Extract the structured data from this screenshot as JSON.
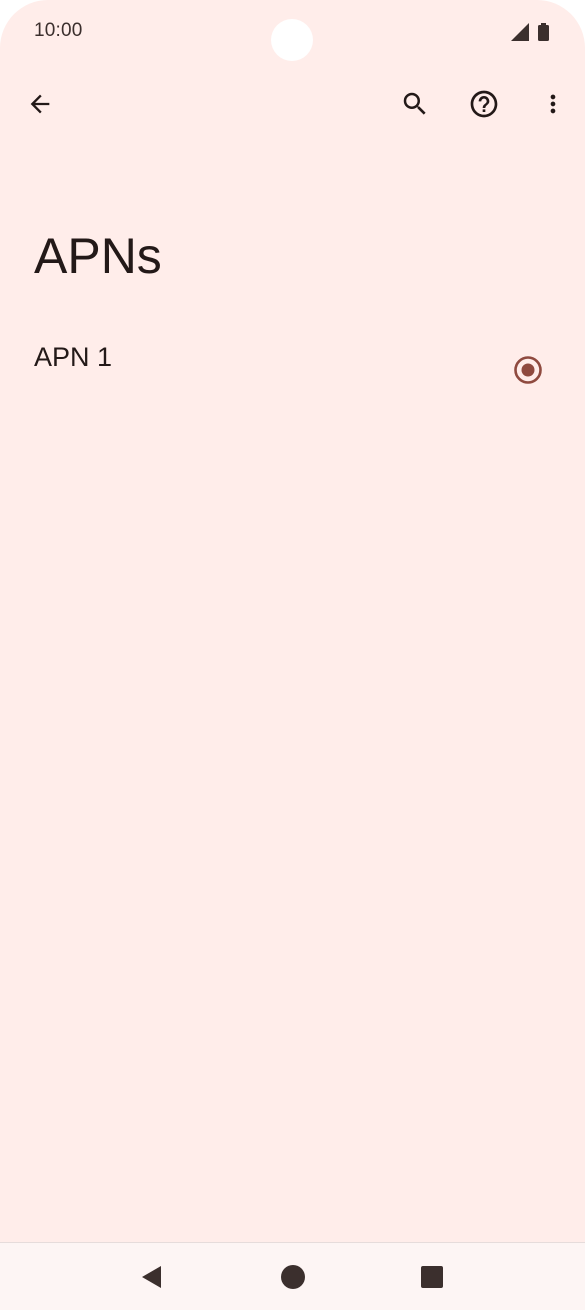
{
  "status_bar": {
    "time": "10:00",
    "icons": [
      "signal-icon",
      "battery-icon"
    ]
  },
  "toolbar": {
    "icons": [
      "back-arrow-icon",
      "search-icon",
      "help-icon",
      "more-vert-icon"
    ]
  },
  "page": {
    "title": "APNs"
  },
  "apn_list": [
    {
      "name": "APN 1",
      "selected": true
    }
  ],
  "nav_bar": {
    "icons": [
      "nav-back-icon",
      "nav-home-icon",
      "nav-recents-icon"
    ]
  },
  "colors": {
    "background": "#ffedea",
    "text": "#231918",
    "accent": "#8f4a3f",
    "nav_bar": "#fdf5f4"
  }
}
